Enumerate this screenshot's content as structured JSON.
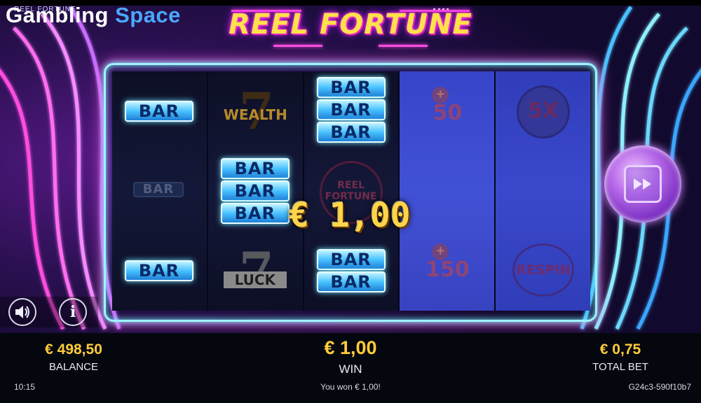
{
  "app": {
    "small_title": "REEL FORTUNE",
    "watermark_part1": "Gambling",
    "watermark_part2": "Space",
    "logo_text": "REEL FORTUNE"
  },
  "reels": {
    "bar_label": "BAR",
    "reel2_top_label": "WEALTH",
    "reel2_bottom_label": "LUCK",
    "reel3_mid_label": "REEL FORTUNE",
    "reel4_top_num": "50",
    "reel4_bottom_num": "150",
    "reel4_plus": "+",
    "reel5_top_label": "5X",
    "reel5_bottom_label": "RESPIN"
  },
  "win_overlay": "€ 1,00",
  "spin_button_icon": "fast-forward-icon",
  "controls": {
    "sound_icon": "speaker-icon",
    "info_icon": "info-icon",
    "info_glyph": "i"
  },
  "bottom": {
    "balance_value": "€ 498,50",
    "balance_label": "BALANCE",
    "win_value": "€ 1,00",
    "win_label": "WIN",
    "bet_value": "€ 0,75",
    "bet_label": "TOTAL BET"
  },
  "status": {
    "time": "10:15",
    "message": "You won € 1,00!",
    "build": "G24c3-590f10b7"
  },
  "colors": {
    "accent_gold": "#ffcc3a",
    "neon_pink": "#ff4ee0",
    "neon_cyan": "#7af0ff"
  }
}
